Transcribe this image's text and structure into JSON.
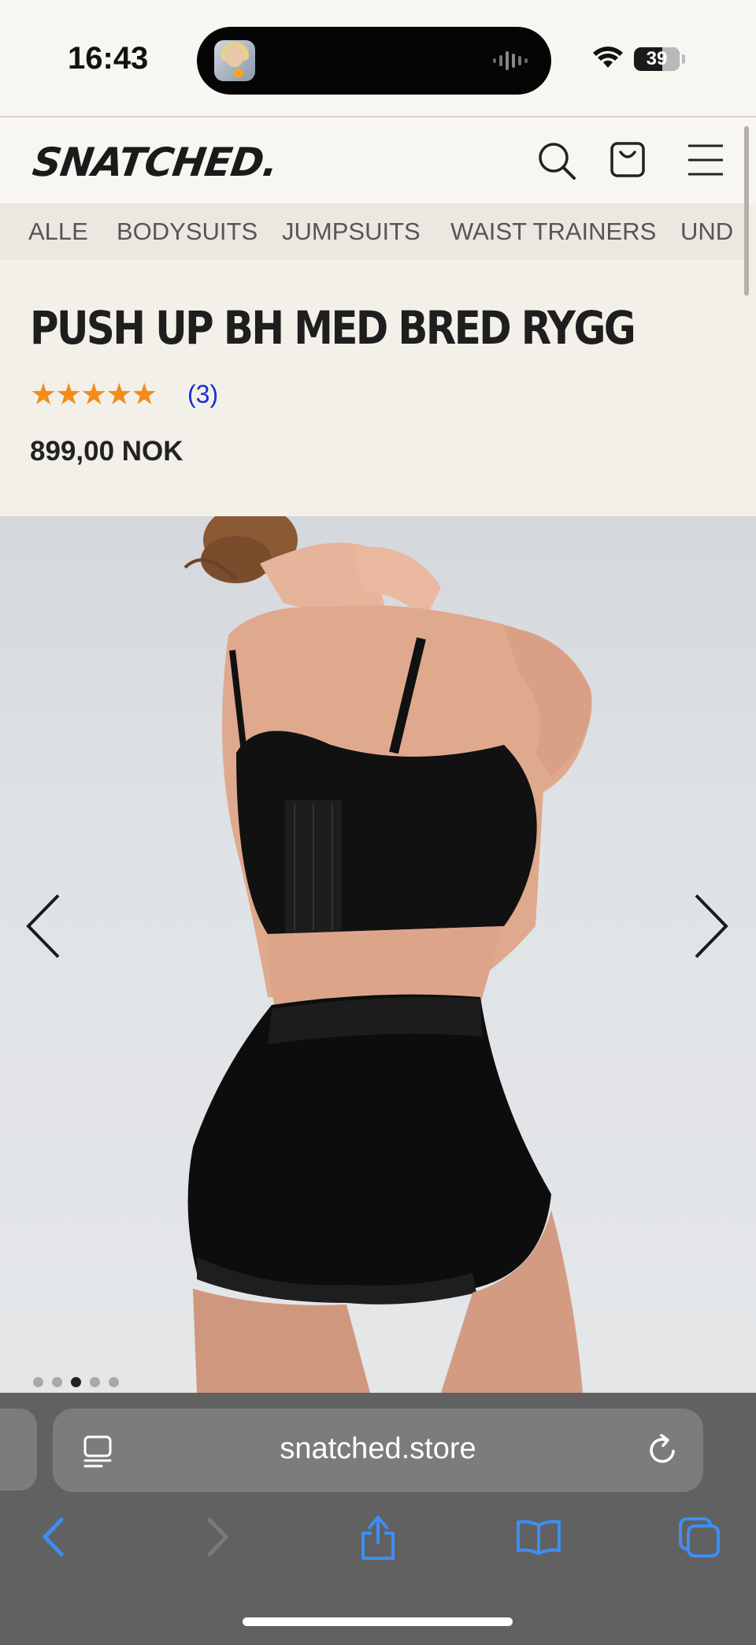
{
  "status_bar": {
    "time": "16:43",
    "battery": "39"
  },
  "header": {
    "logo": "SNATCHED."
  },
  "categories": [
    "ALLE",
    "BODYSUITS",
    "JUMPSUITS",
    "WAIST TRAINERS",
    "UND"
  ],
  "product": {
    "title": "PUSH UP BH MED BRED RYGG",
    "stars": 5,
    "review_count": "(3)",
    "price": "899,00 NOK"
  },
  "gallery": {
    "image_index": 3,
    "image_count": 5
  },
  "browser": {
    "url": "snatched.store"
  },
  "colors": {
    "star": "#f28c1a",
    "link": "#1a2fd1",
    "accent": "#3b8ff5",
    "page_bg": "#f3f0ea"
  },
  "icons": [
    "search-icon",
    "bag-icon",
    "menu-icon",
    "chevron-left-icon",
    "chevron-right-icon",
    "reader-icon",
    "reload-icon",
    "back-icon",
    "forward-icon",
    "share-icon",
    "bookmarks-icon",
    "tabs-icon"
  ]
}
